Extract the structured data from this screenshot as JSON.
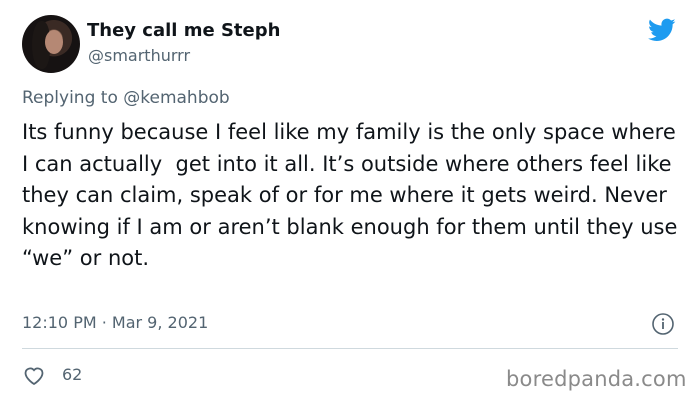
{
  "author": {
    "display_name": "They call me Steph",
    "handle": "@smarthurrr"
  },
  "reply": {
    "prefix": "Replying to",
    "mention": "@kemahbob"
  },
  "tweet": {
    "text": "Its funny because I feel like my family is the only space where I can actually  get into it all. It’s outside where others feel like they can claim, speak of or for me where it gets weird. Never knowing if I am or aren’t blank enough for them until they use “we” or not.",
    "timestamp": "12:10 PM · Mar 9, 2021"
  },
  "engagement": {
    "likes": "62"
  },
  "watermark": "boredpanda.com",
  "colors": {
    "twitter_blue": "#1d9bf0",
    "secondary_text": "#536471"
  },
  "icons": [
    "twitter-bird-icon",
    "info-icon",
    "heart-icon"
  ]
}
